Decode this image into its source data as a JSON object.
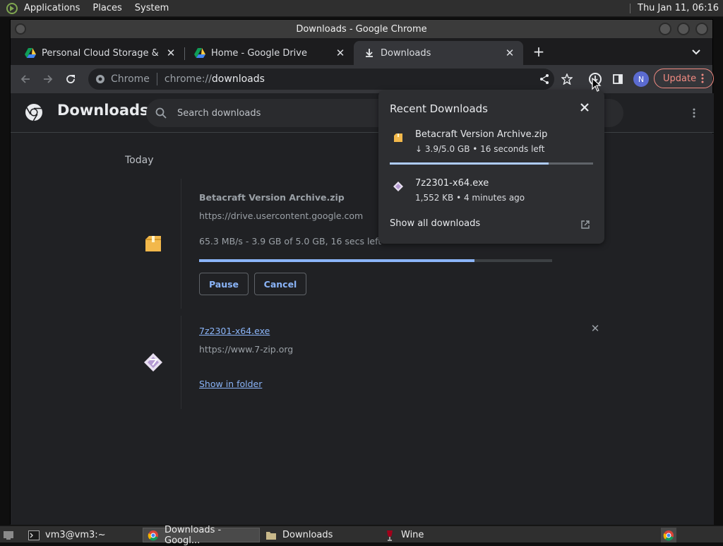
{
  "desktop": {
    "menus": [
      "Applications",
      "Places",
      "System"
    ],
    "clock": "Thu Jan 11, 06:16"
  },
  "window": {
    "title": "Downloads - Google Chrome"
  },
  "tabs": [
    {
      "label": "Personal Cloud Storage & File",
      "icon": "google-drive-icon"
    },
    {
      "label": "Home - Google Drive",
      "icon": "google-drive-icon"
    },
    {
      "label": "Downloads",
      "icon": "download-icon",
      "active": true
    }
  ],
  "omnibox": {
    "chip": "Chrome",
    "scheme": "chrome://",
    "host": "downloads"
  },
  "profile": {
    "initial": "N"
  },
  "update_label": "Update",
  "page": {
    "title": "Downloads",
    "search_placeholder": "Search downloads",
    "group_label": "Today"
  },
  "downloads": [
    {
      "name": "Betacraft Version Archive.zip",
      "source": "https://drive.usercontent.google.com",
      "status": "65.3 MB/s - 3.9 GB of 5.0 GB, 16 secs left",
      "progress": 0.78,
      "pause_label": "Pause",
      "cancel_label": "Cancel"
    },
    {
      "name": "7z2301-x64.exe",
      "source": "https://www.7-zip.org",
      "action_label": "Show in folder"
    }
  ],
  "bubble": {
    "title": "Recent Downloads",
    "items": [
      {
        "name": "Betacraft Version Archive.zip",
        "status": "↓ 3.9/5.0 GB • 16 seconds left",
        "progress": 0.78
      },
      {
        "name": "7z2301-x64.exe",
        "status": "1,552 KB • 4 minutes ago"
      }
    ],
    "show_all": "Show all downloads"
  },
  "taskbar": [
    {
      "label": "vm3@vm3:~",
      "icon": "terminal-icon"
    },
    {
      "label": "Downloads - Googl...",
      "icon": "chrome-icon",
      "active": true
    },
    {
      "label": "Downloads",
      "icon": "folder-icon"
    },
    {
      "label": "Wine",
      "icon": "wine-icon"
    }
  ],
  "colors": {
    "accent": "#8ab4f8",
    "update": "#f28b82",
    "background": "#202124"
  }
}
